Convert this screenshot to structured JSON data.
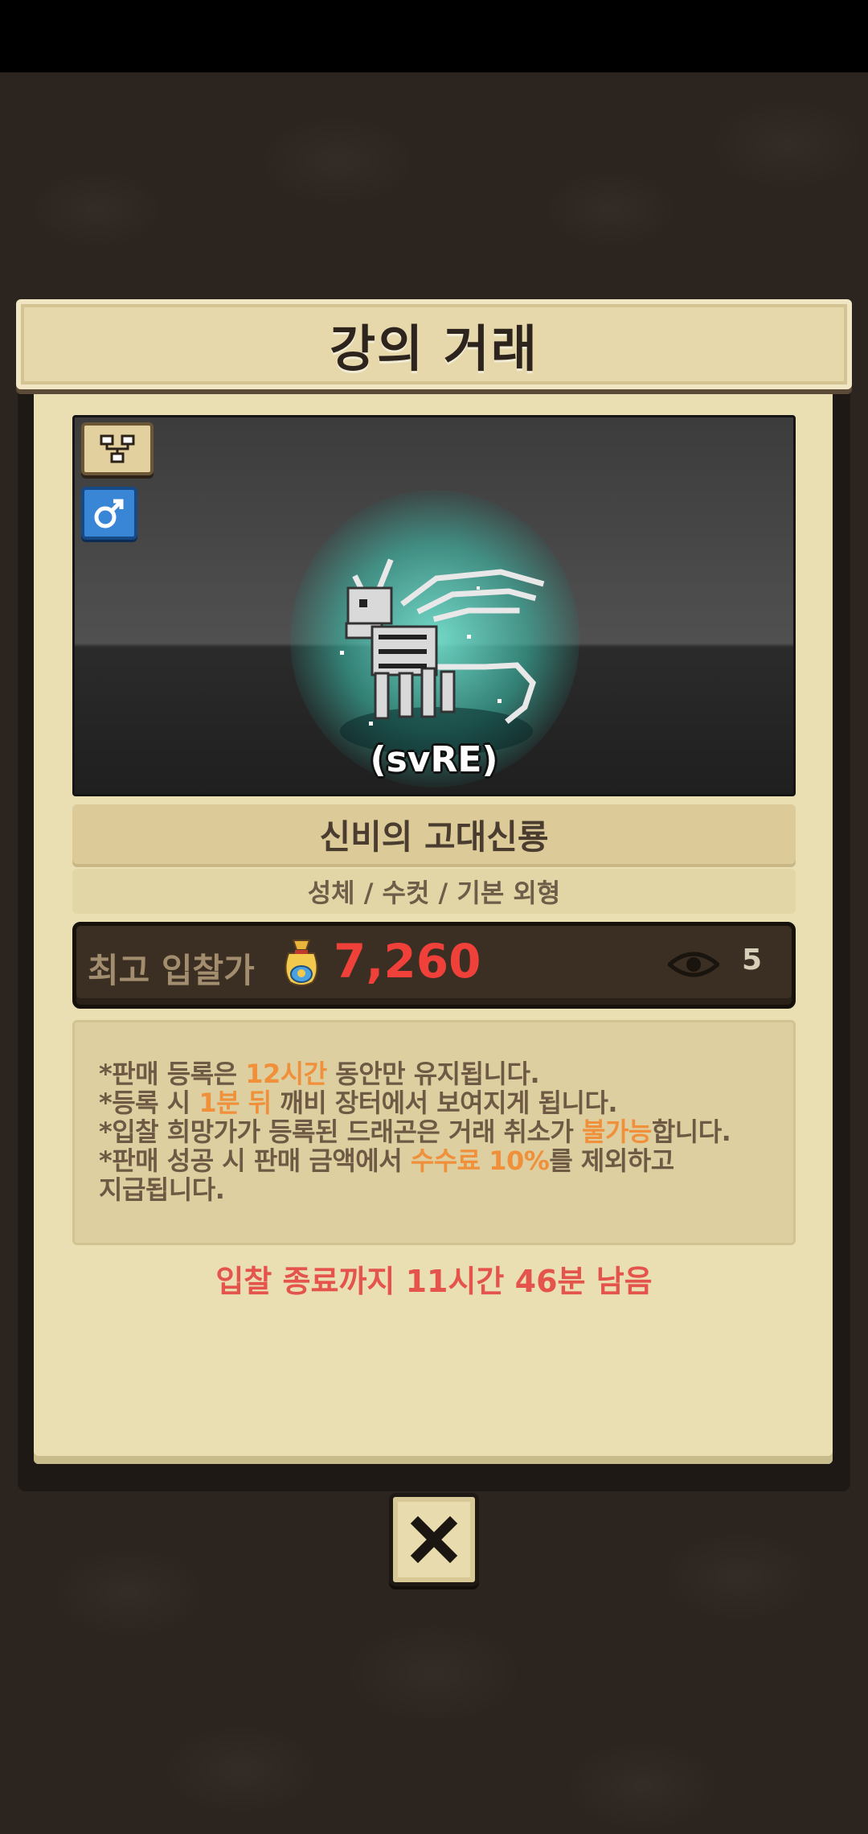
{
  "dialog": {
    "title": "강의 거래"
  },
  "preview": {
    "nickname": "(svRE)",
    "badges": [
      "family-tree-icon",
      "male-icon"
    ],
    "glow_color": "#6fe8d6"
  },
  "dragon": {
    "name": "신비의 고대신룡",
    "attributes": "성체 / 수컷 / 기본 외형"
  },
  "bid": {
    "label": "최고 입찰가",
    "icon": "gold-pouch-icon",
    "value": "7,260",
    "view_icon": "eye-icon",
    "view_count": "5"
  },
  "info": {
    "lines": [
      {
        "a": "*판매 등록은 ",
        "b": "12시간",
        "c": " 동안만 유지됩니다."
      },
      {
        "a": "*등록 시 ",
        "b": "1분 뒤",
        "c": " 깨비 장터에서 보여지게 됩니다."
      },
      {
        "a": "*입찰 희망가가 등록된 드래곤은 거래 취소가 ",
        "b": "불가능",
        "c": "합니다."
      },
      {
        "a": "*판매 성공 시 판매 금액에서 ",
        "b": "수수료 10%",
        "c": "를 제외하고"
      },
      {
        "a": "지급됩니다.",
        "b": "",
        "c": ""
      }
    ]
  },
  "remaining_time": "입찰 종료까지 11시간 46분 남음",
  "close_icon": "close-icon",
  "colors": {
    "highlight": "#f0903a",
    "bid_value": "#f0403a",
    "remaining": "#e4544c",
    "panel": "#e9dfb2"
  }
}
